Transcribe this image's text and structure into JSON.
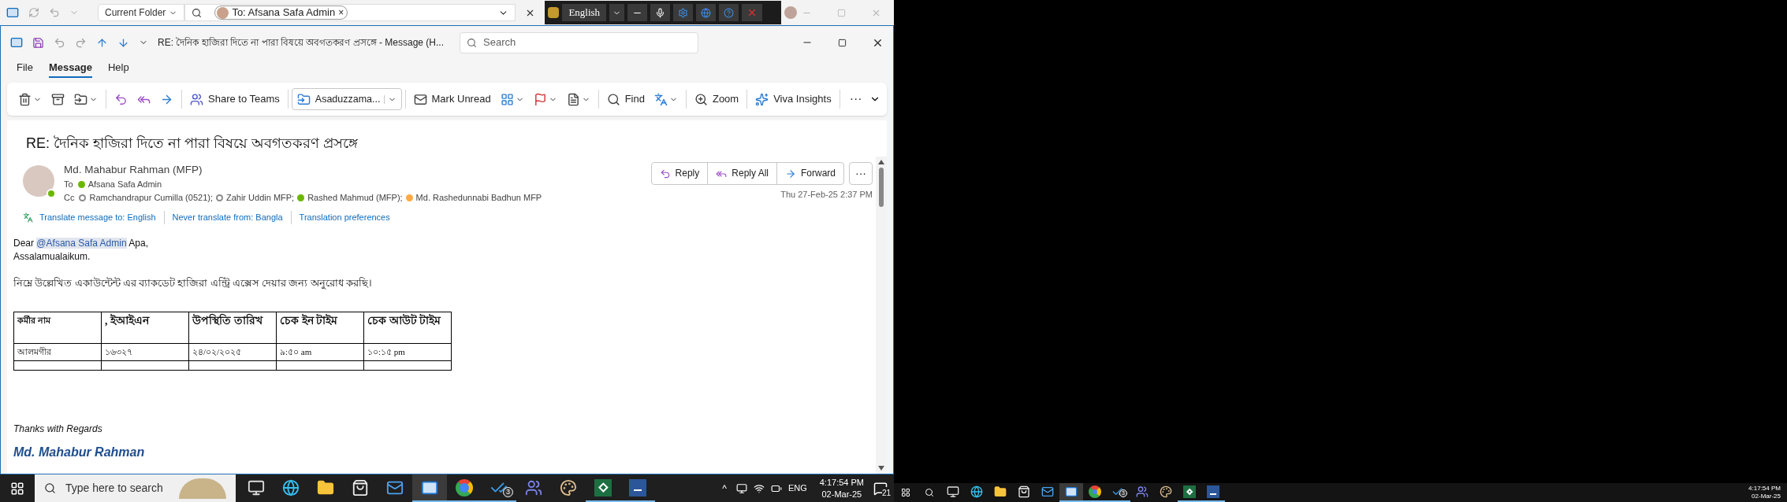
{
  "back_window": {
    "scope": "Current Folder",
    "search_tab": "To: Afsana Safa Admin",
    "close_glyph": "×"
  },
  "language_bar": {
    "language": "English"
  },
  "title_bar": {
    "title": "RE:  দৈনিক হাজিরা দিতে না পারা  বিষয়ে অবগতকরণ প্রসঙ্গে  -  Message (H...",
    "search_placeholder": "Search"
  },
  "menu": [
    {
      "label": "File",
      "selected": false
    },
    {
      "label": "Message",
      "selected": true
    },
    {
      "label": "Help",
      "selected": false
    }
  ],
  "ribbon": [
    {
      "kind": "delete",
      "dropdown": true
    },
    {
      "kind": "archive",
      "dropdown": false
    },
    {
      "kind": "move",
      "dropdown": true
    },
    {
      "kind": "sep"
    },
    {
      "kind": "reply"
    },
    {
      "kind": "reply-all"
    },
    {
      "kind": "forward"
    },
    {
      "kind": "sep"
    },
    {
      "kind": "teams",
      "label": "Share to Teams"
    },
    {
      "kind": "sep"
    },
    {
      "kind": "quick-step",
      "label": "Asaduzzama..."
    },
    {
      "kind": "sep"
    },
    {
      "kind": "unread",
      "label": "Mark Unread"
    },
    {
      "kind": "categorize",
      "dropdown": true
    },
    {
      "kind": "flag",
      "dropdown": true
    },
    {
      "kind": "policy",
      "dropdown": true
    },
    {
      "kind": "sep"
    },
    {
      "kind": "find",
      "label": "Find"
    },
    {
      "kind": "translate",
      "dropdown": true
    },
    {
      "kind": "sep"
    },
    {
      "kind": "zoom",
      "label": "Zoom"
    },
    {
      "kind": "sep"
    },
    {
      "kind": "insights",
      "label": "Viva Insights"
    },
    {
      "kind": "sep"
    },
    {
      "kind": "more",
      "label": "···"
    }
  ],
  "message": {
    "subject": "RE:  দৈনিক হাজিরা দিতে না পারা  বিষয়ে অবগতকরণ প্রসঙ্গে",
    "sender": "Md. Mahabur Rahman (MFP)",
    "to_label": "To",
    "to": [
      {
        "name": "Afsana Safa Admin",
        "color": "#6bb700",
        "offline": false
      }
    ],
    "cc_label": "Cc",
    "cc": [
      {
        "name": "Ramchandrapur Cumilla (0521);",
        "color": "#8a8a8a",
        "offline": true
      },
      {
        "name": "Zahir Uddin MFP;",
        "color": "#8a8a8a",
        "offline": true
      },
      {
        "name": "Rashed Mahmud (MFP);",
        "color": "#6bb700",
        "offline": false
      },
      {
        "name": "Md. Rashedunnabi Badhun MFP",
        "color": "#ffaa44",
        "offline": false
      }
    ],
    "actions": [
      {
        "kind": "reply",
        "label": "Reply"
      },
      {
        "kind": "reply-all",
        "label": "Reply All"
      },
      {
        "kind": "forward",
        "label": "Forward"
      }
    ],
    "more": "···",
    "date": "Thu 27-Feb-25 2:37 PM",
    "translate_links": [
      "Translate message to: English",
      "Never translate from: Bangla",
      "Translation preferences"
    ]
  },
  "body": {
    "greeting_pre": "Dear",
    "mention": "@Afsana Safa Admin",
    "greeting_post": "Apa,",
    "salam": "Assalamualaikum.",
    "request": "নিম্নে উল্লেখিত একাউন্টেন্ট এর ব্যাকডেট হাজিরা এন্ট্রি এক্সেস দেয়ার জন্য অনুরোধ করছি।",
    "table": {
      "columns": [
        "কর্মীর নাম",
        ", ইআইএন",
        "উপস্থিতি তারিখ",
        "চেক ইন টাইম",
        "চেক আউট টাইম"
      ],
      "rows": [
        [
          "আলমগীর",
          "১৬৩২৭",
          "২৪/০২/২০২৫",
          "৯:৫০ am",
          "১০:১৫ pm"
        ]
      ]
    },
    "closing": "Thanks with Regards",
    "signature": "Md. Mahabur Rahman"
  },
  "taskbar": {
    "search_placeholder": "Type here to search",
    "apps": [
      {
        "kind": "taskview",
        "open": false,
        "selected": false
      },
      {
        "kind": "edge",
        "open": false,
        "selected": false
      },
      {
        "kind": "folder",
        "open": false,
        "selected": false
      },
      {
        "kind": "store",
        "open": false,
        "selected": false
      },
      {
        "kind": "outlook-new",
        "open": false,
        "selected": false
      },
      {
        "kind": "outlook",
        "open": true,
        "selected": true
      },
      {
        "kind": "chrome",
        "open": true,
        "selected": false
      },
      {
        "kind": "todo",
        "open": true,
        "selected": false,
        "badge": "3"
      },
      {
        "kind": "teams",
        "open": false,
        "selected": false
      },
      {
        "kind": "paint",
        "open": false,
        "selected": false
      },
      {
        "kind": "excel",
        "open": true,
        "selected": false
      },
      {
        "kind": "word",
        "open": true,
        "selected": false
      }
    ],
    "tray_chevron": "^",
    "language": "ENG",
    "time": "4:17:54 PM",
    "date": "02-Mar-25",
    "notifications": "21"
  },
  "second_taskbar": {
    "time": "4:17:54 PM",
    "date": "02-Mar-25",
    "badge": "3"
  }
}
